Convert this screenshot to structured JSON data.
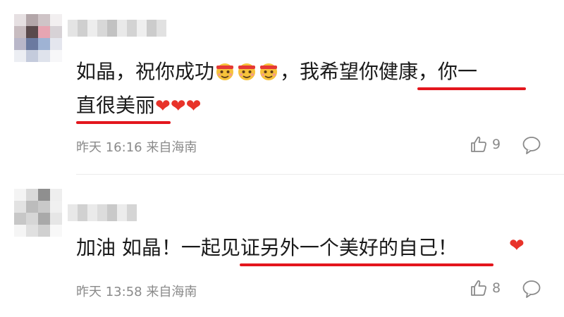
{
  "comments": [
    {
      "line1": {
        "seg_a": "如晶，祝你成功",
        "seg_b": "，我希望你",
        "seg_c": "健康，你一"
      },
      "line2": {
        "seg_a": "直很美丽"
      },
      "time": "昨天 16:16",
      "location": "来自海南",
      "likes": "9"
    },
    {
      "line1": {
        "seg_a": "加油 如晶！一起",
        "seg_b": "见证另外一个美好的自己！"
      },
      "time": "昨天 13:58",
      "location": "来自海南",
      "likes": "8"
    }
  ],
  "emojis": [
    "struggle-emoji",
    "struggle-emoji",
    "struggle-emoji"
  ],
  "colors": {
    "underline": "#e3161d",
    "heart": "#e8332a",
    "meta": "#8a8a8a"
  }
}
